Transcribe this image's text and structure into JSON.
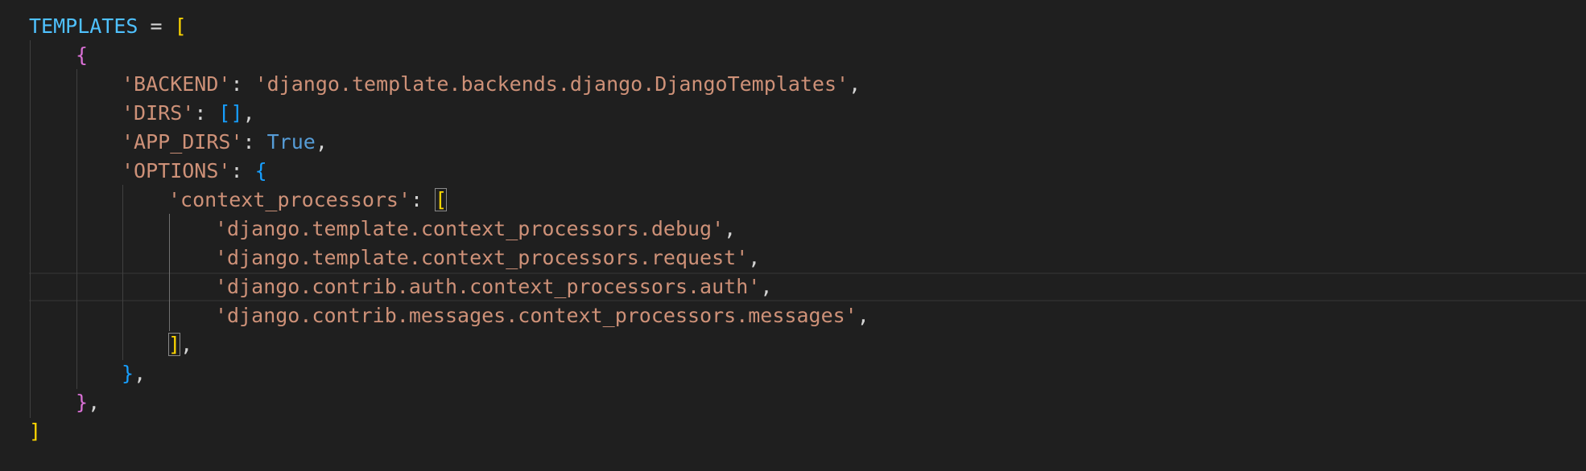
{
  "editor": {
    "language": "python",
    "colors": {
      "background": "#1f1f1f",
      "variable": "#4fc1ff",
      "string": "#ce9178",
      "keyword": "#569cd6",
      "bracket_level_1": "#ffd700",
      "bracket_level_2": "#da70d6",
      "bracket_level_3": "#179fff"
    },
    "lines": [
      {
        "var": "TEMPLATES",
        "eq": " = ",
        "open": "["
      },
      {
        "open": "{"
      },
      {
        "key": "'BACKEND'",
        "colon": ": ",
        "value": "'django.template.backends.django.DjangoTemplates'",
        "comma": ","
      },
      {
        "key": "'DIRS'",
        "colon": ": ",
        "value": "[]",
        "comma": ","
      },
      {
        "key": "'APP_DIRS'",
        "colon": ": ",
        "value": "True",
        "comma": ","
      },
      {
        "key": "'OPTIONS'",
        "colon": ": ",
        "open": "{"
      },
      {
        "key": "'context_processors'",
        "colon": ": ",
        "open": "["
      },
      {
        "value": "'django.template.context_processors.debug'",
        "comma": ","
      },
      {
        "value": "'django.template.context_processors.request'",
        "comma": ","
      },
      {
        "value": "'django.contrib.auth.context_processors.auth'",
        "comma": ","
      },
      {
        "value": "'django.contrib.messages.context_processors.messages'",
        "comma": ","
      },
      {
        "close": "]",
        "comma": ","
      },
      {
        "close": "}",
        "comma": ","
      },
      {
        "close": "}",
        "comma": ","
      },
      {
        "close": "]"
      }
    ]
  }
}
